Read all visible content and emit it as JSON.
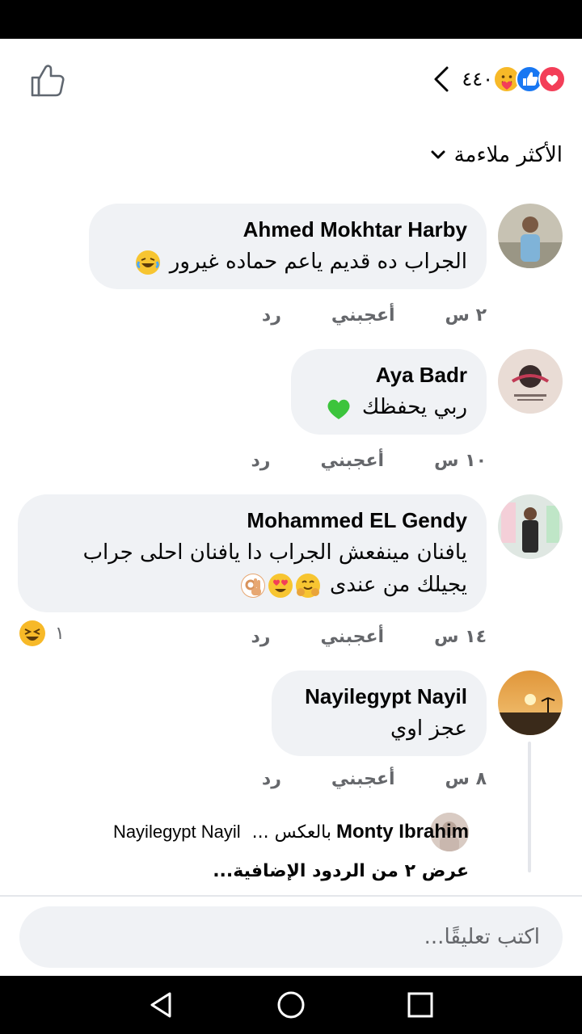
{
  "header": {
    "reaction_count": "٤٤٠",
    "reactions": [
      "care-icon",
      "like-icon",
      "love-icon"
    ]
  },
  "sort": {
    "label": "الأكثر ملاءمة"
  },
  "comments": [
    {
      "author": "Ahmed Mokhtar Harby",
      "text": "الجراب ده قديم ياعم حماده غيرور",
      "emoji": "laughing-tears-emoji",
      "time": "٢ س",
      "like": "أعجبني",
      "reply": "رد"
    },
    {
      "author": "Aya Badr",
      "text": "ربي يحفظك",
      "emoji": "green-heart-emoji",
      "time": "١٠ س",
      "like": "أعجبني",
      "reply": "رد"
    },
    {
      "author": "Mohammed EL Gendy",
      "text_line1": "يافنان مينفعش الجراب دا يافنان احلى جراب",
      "text_line2": "يجيلك من عندى",
      "emojis": [
        "hugging-emoji",
        "heart-eyes-emoji",
        "ok-hand-emoji"
      ],
      "time": "١٤ س",
      "like": "أعجبني",
      "reply": "رد",
      "reaction_count": "١",
      "reaction": "haha-icon"
    },
    {
      "author": "Nayilegypt Nayil",
      "text": "عجز اوي",
      "time": "٨ س",
      "like": "أعجبني",
      "reply": "رد",
      "reply_preview": {
        "author": "Monty Ibrahim",
        "text": "بالعكس ...",
        "mention": "Nayilegypt Nayil"
      },
      "more_replies": "عرض ٢ من الردود الإضافية..."
    }
  ],
  "composer": {
    "placeholder": "اكتب تعليقًا..."
  },
  "navigation": [
    "back-icon",
    "home-icon",
    "recents-icon"
  ]
}
